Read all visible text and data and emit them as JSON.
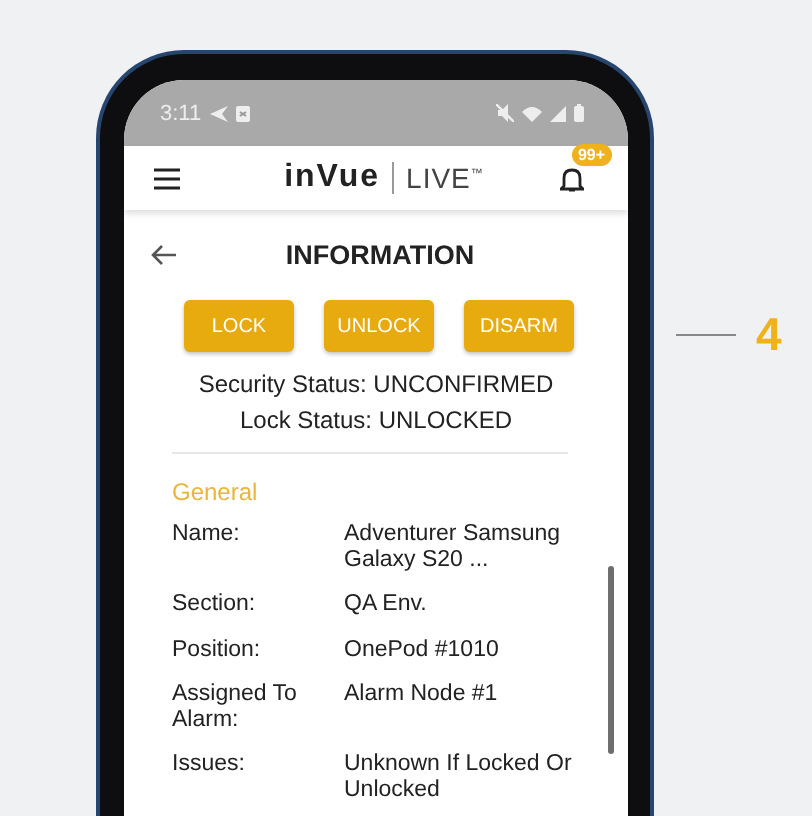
{
  "status_bar": {
    "time": "3:11"
  },
  "header": {
    "brand": "inVue",
    "product": "LIVE$^{™}$",
    "badge": "99+"
  },
  "page_title": "INFORMATION",
  "buttons": [
    "LOCK",
    "UNLOCK",
    "DISARM"
  ],
  "statuses": [
    "Security Status: UNCONFIRMED",
    "Lock Status: UNLOCKED"
  ],
  "section": "General",
  "fields": [
    {
      "label": "Name:",
      "value": "Adventurer Samsung Galaxy S20 ..."
    },
    {
      "label": "Section:",
      "value": "QA Env."
    },
    {
      "label": "Position:",
      "value": "OnePod #1010"
    },
    {
      "label": "Assigned To Alarm:",
      "value": "Alarm Node #1"
    },
    {
      "label": "Issues:",
      "value": "Unknown If Locked Or Unlocked"
    }
  ],
  "callout": "4"
}
